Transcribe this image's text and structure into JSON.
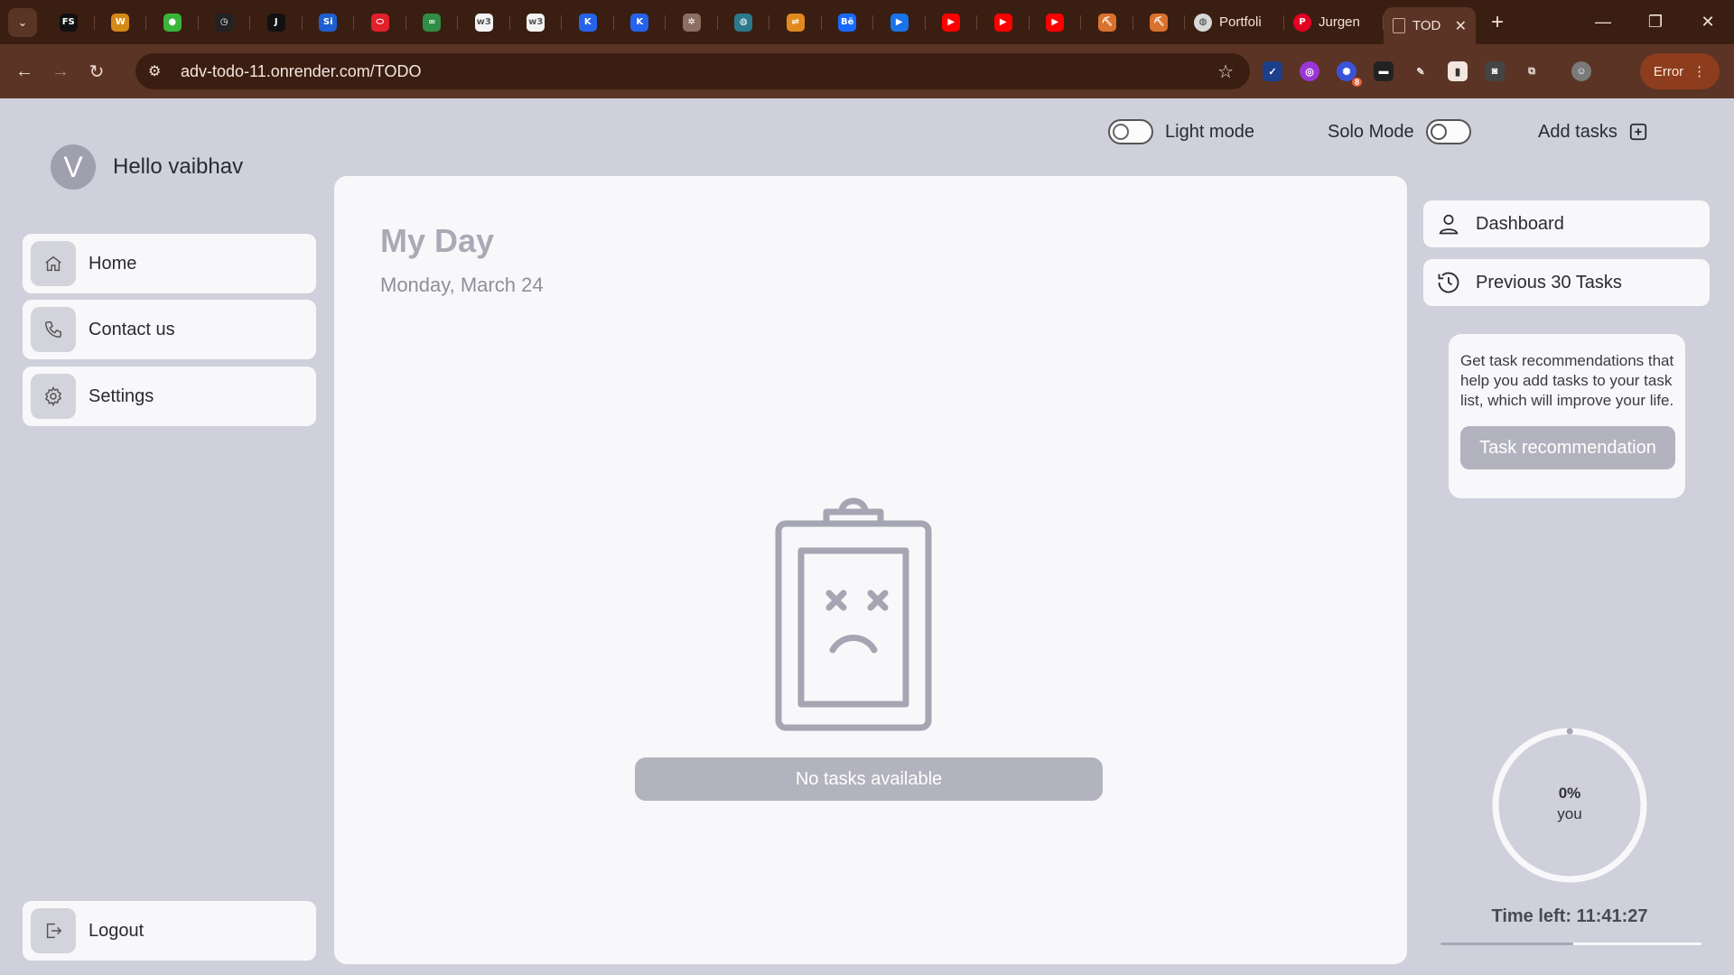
{
  "browser": {
    "pinned_tabs": [
      {
        "icon": "fs-icon",
        "glyph": "FS",
        "color": "#111111"
      },
      {
        "icon": "w-icon",
        "glyph": "W",
        "color": "#d48a16"
      },
      {
        "icon": "leaf-icon",
        "glyph": "●",
        "color": "#3ab43a"
      },
      {
        "icon": "clock-icon",
        "glyph": "◷",
        "color": "#222222"
      },
      {
        "icon": "j-icon",
        "glyph": "J",
        "color": "#111111"
      },
      {
        "icon": "si-icon",
        "glyph": "Si",
        "color": "#1d5fd0"
      },
      {
        "icon": "oval-icon",
        "glyph": "⬭",
        "color": "#e0202a"
      },
      {
        "icon": "gfg-icon",
        "glyph": "∞",
        "color": "#2f8d46"
      },
      {
        "icon": "w3-icon",
        "glyph": "w3",
        "color": "#f4f4f4"
      },
      {
        "icon": "w3-icon-2",
        "glyph": "w3",
        "color": "#f4f4f4"
      },
      {
        "icon": "k-icon",
        "glyph": "K",
        "color": "#2563eb"
      },
      {
        "icon": "k-icon-2",
        "glyph": "K",
        "color": "#2563eb"
      },
      {
        "icon": "network-icon",
        "glyph": "✲",
        "color": "#8d6e63"
      },
      {
        "icon": "globe-icon",
        "glyph": "◍",
        "color": "#2b7a8b"
      },
      {
        "icon": "arrow-icon",
        "glyph": "⇌",
        "color": "#e08a1e"
      },
      {
        "icon": "behance-icon",
        "glyph": "Bē",
        "color": "#1769ff"
      },
      {
        "icon": "play-circle-icon",
        "glyph": "▶",
        "color": "#1a73e8"
      },
      {
        "icon": "youtube-icon",
        "glyph": "▶",
        "color": "#ff0000"
      },
      {
        "icon": "youtube-icon-2",
        "glyph": "▶",
        "color": "#ff0000"
      },
      {
        "icon": "youtube-icon-3",
        "glyph": "▶",
        "color": "#ff0000"
      },
      {
        "icon": "tool-icon",
        "glyph": "⛏",
        "color": "#d9722c"
      },
      {
        "icon": "tool-icon-2",
        "glyph": "⛏",
        "color": "#d9722c"
      }
    ],
    "tabs": [
      {
        "label": "Portfoli",
        "icon": "globe-icon"
      },
      {
        "label": "Jurgen",
        "icon": "pinterest-icon"
      },
      {
        "label": "TOD",
        "icon": "doc-icon",
        "active": true
      }
    ],
    "url": "adv-todo-11.onrender.com/TODO",
    "error_label": "Error",
    "ext_badge": "8"
  },
  "app": {
    "avatar_letter": "V",
    "greeting": "Hello vaibhav",
    "nav": [
      {
        "label": "Home",
        "icon": "home-icon"
      },
      {
        "label": "Contact us",
        "icon": "phone-icon"
      },
      {
        "label": "Settings",
        "icon": "gear-icon"
      }
    ],
    "logout_label": "Logout",
    "light_mode_label": "Light mode",
    "solo_mode_label": "Solo Mode",
    "add_tasks_label": "Add tasks",
    "title": "My Day",
    "date": "Monday, March 24",
    "empty_label": "No tasks available",
    "right_nav": [
      {
        "label": "Dashboard",
        "icon": "user-icon"
      },
      {
        "label": "Previous 30 Tasks",
        "icon": "history-icon"
      }
    ],
    "recommendation_text": "Get task recommendations that help you add tasks to your task list, which will improve your life.",
    "recommendation_button": "Task recommendation",
    "progress_percent": "0%",
    "progress_owner": "you",
    "progress_value": 0,
    "time_left": "Time left: 11:41:27",
    "time_bar_fraction": 0.51
  }
}
